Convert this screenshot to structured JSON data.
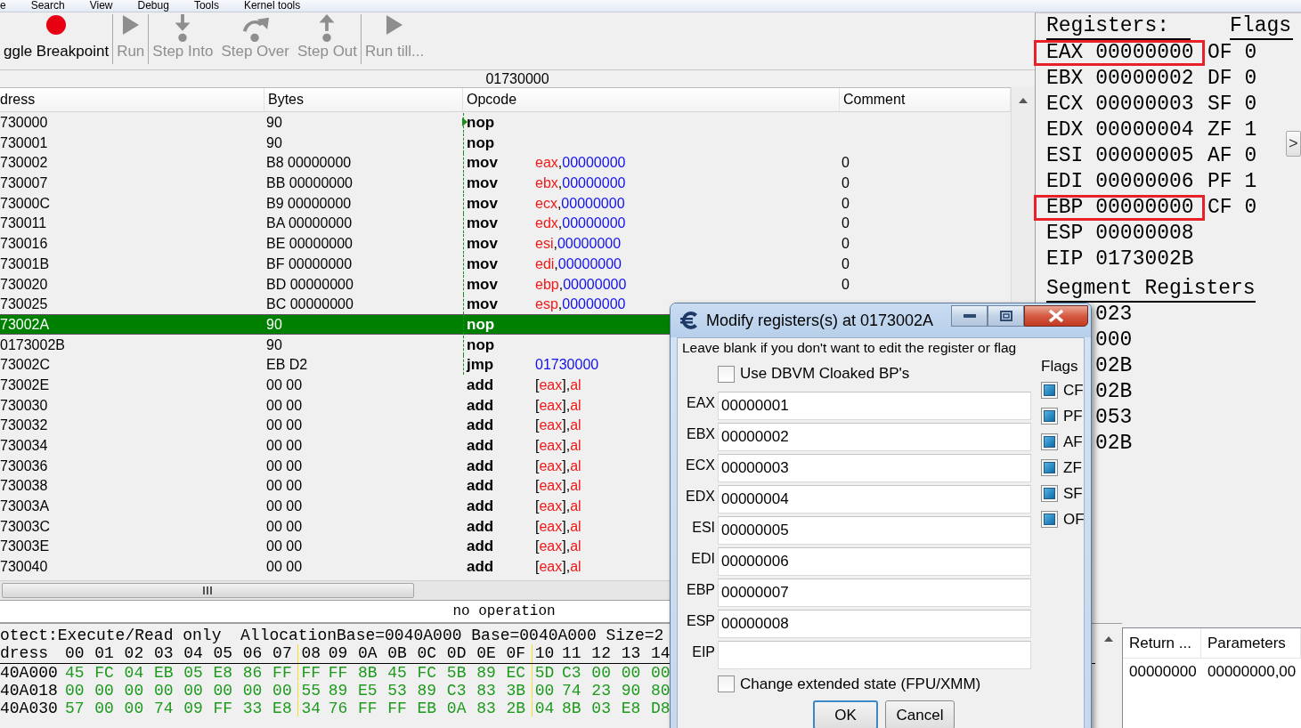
{
  "menu": [
    "e",
    "Search",
    "View",
    "Debug",
    "Tools",
    "Kernel tools"
  ],
  "toolbar": [
    {
      "kind": "breakpoint",
      "label": "ggle Breakpoint",
      "disabled": false,
      "separator_after": true
    },
    {
      "kind": "run",
      "label": "Run",
      "disabled": true,
      "separator_after": true
    },
    {
      "kind": "step_into",
      "label": "Step Into",
      "disabled": true,
      "separator_after": false
    },
    {
      "kind": "step_over",
      "label": "Step Over",
      "disabled": true,
      "separator_after": false
    },
    {
      "kind": "step_out",
      "label": "Step Out",
      "disabled": true,
      "separator_after": true
    },
    {
      "kind": "run",
      "label": "Run till...",
      "disabled": true,
      "separator_after": false
    }
  ],
  "address_bar": "01730000",
  "disassembly": {
    "columns": [
      "dress",
      "Bytes",
      "Opcode",
      "Comment"
    ],
    "rows": [
      {
        "address": "730000",
        "bytes": "90",
        "mnemonic": "nop",
        "selected": false,
        "jump_line": true,
        "jump_target": true
      },
      {
        "address": "730001",
        "bytes": "90",
        "mnemonic": "nop",
        "selected": false,
        "jump_line": true,
        "jump_target": false
      },
      {
        "address": "730002",
        "bytes": "B8 00000000",
        "mnemonic": "mov",
        "operand": [
          {
            "kind": "reg",
            "text": "eax"
          },
          {
            "kind": "sep",
            "text": ","
          },
          {
            "kind": "num",
            "text": "00000000"
          }
        ],
        "comment": "0",
        "selected": false,
        "jump_line": true,
        "jump_target": false
      },
      {
        "address": "730007",
        "bytes": "BB 00000000",
        "mnemonic": "mov",
        "operand": [
          {
            "kind": "reg",
            "text": "ebx"
          },
          {
            "kind": "sep",
            "text": ","
          },
          {
            "kind": "num",
            "text": "00000000"
          }
        ],
        "comment": "0",
        "selected": false,
        "jump_line": true,
        "jump_target": false
      },
      {
        "address": "73000C",
        "bytes": "B9 00000000",
        "mnemonic": "mov",
        "operand": [
          {
            "kind": "reg",
            "text": "ecx"
          },
          {
            "kind": "sep",
            "text": ","
          },
          {
            "kind": "num",
            "text": "00000000"
          }
        ],
        "comment": "0",
        "selected": false,
        "jump_line": true,
        "jump_target": false
      },
      {
        "address": "730011",
        "bytes": "BA 00000000",
        "mnemonic": "mov",
        "operand": [
          {
            "kind": "reg",
            "text": "edx"
          },
          {
            "kind": "sep",
            "text": ","
          },
          {
            "kind": "num",
            "text": "00000000"
          }
        ],
        "comment": "0",
        "selected": false,
        "jump_line": true,
        "jump_target": false
      },
      {
        "address": "730016",
        "bytes": "BE 00000000",
        "mnemonic": "mov",
        "operand": [
          {
            "kind": "reg",
            "text": "esi"
          },
          {
            "kind": "sep",
            "text": ","
          },
          {
            "kind": "num",
            "text": "00000000"
          }
        ],
        "comment": "0",
        "selected": false,
        "jump_line": true,
        "jump_target": false
      },
      {
        "address": "73001B",
        "bytes": "BF 00000000",
        "mnemonic": "mov",
        "operand": [
          {
            "kind": "reg",
            "text": "edi"
          },
          {
            "kind": "sep",
            "text": ","
          },
          {
            "kind": "num",
            "text": "00000000"
          }
        ],
        "comment": "0",
        "selected": false,
        "jump_line": true,
        "jump_target": false
      },
      {
        "address": "730020",
        "bytes": "BD 00000000",
        "mnemonic": "mov",
        "operand": [
          {
            "kind": "reg",
            "text": "ebp"
          },
          {
            "kind": "sep",
            "text": ","
          },
          {
            "kind": "num",
            "text": "00000000"
          }
        ],
        "comment": "0",
        "selected": false,
        "jump_line": true,
        "jump_target": false
      },
      {
        "address": "730025",
        "bytes": "BC 00000000",
        "mnemonic": "mov",
        "operand": [
          {
            "kind": "reg",
            "text": "esp"
          },
          {
            "kind": "sep",
            "text": ","
          },
          {
            "kind": "num",
            "text": "00000000"
          }
        ],
        "selected": false,
        "jump_line": true,
        "jump_target": false
      },
      {
        "address": "73002A",
        "bytes": "90",
        "mnemonic": "nop",
        "selected": true,
        "jump_line": true,
        "jump_target": false
      },
      {
        "address": "0173002B",
        "bytes": "90",
        "mnemonic": "nop",
        "selected": false,
        "jump_line": true,
        "jump_target": false
      },
      {
        "address": "73002C",
        "bytes": "EB D2",
        "mnemonic": "jmp",
        "operand": [
          {
            "kind": "num",
            "text": "01730000"
          }
        ],
        "selected": false,
        "jump_line": true,
        "jump_target": false
      },
      {
        "address": "73002E",
        "bytes": "00 00",
        "mnemonic": "add",
        "operand": [
          {
            "kind": "sep",
            "text": "["
          },
          {
            "kind": "reg",
            "text": "eax"
          },
          {
            "kind": "sep",
            "text": "],"
          },
          {
            "kind": "reg",
            "text": "al"
          }
        ],
        "selected": false,
        "jump_line": false,
        "jump_target": false
      },
      {
        "address": "730030",
        "bytes": "00 00",
        "mnemonic": "add",
        "operand": [
          {
            "kind": "sep",
            "text": "["
          },
          {
            "kind": "reg",
            "text": "eax"
          },
          {
            "kind": "sep",
            "text": "],"
          },
          {
            "kind": "reg",
            "text": "al"
          }
        ],
        "selected": false,
        "jump_line": false,
        "jump_target": false
      },
      {
        "address": "730032",
        "bytes": "00 00",
        "mnemonic": "add",
        "operand": [
          {
            "kind": "sep",
            "text": "["
          },
          {
            "kind": "reg",
            "text": "eax"
          },
          {
            "kind": "sep",
            "text": "],"
          },
          {
            "kind": "reg",
            "text": "al"
          }
        ],
        "selected": false,
        "jump_line": false,
        "jump_target": false
      },
      {
        "address": "730034",
        "bytes": "00 00",
        "mnemonic": "add",
        "operand": [
          {
            "kind": "sep",
            "text": "["
          },
          {
            "kind": "reg",
            "text": "eax"
          },
          {
            "kind": "sep",
            "text": "],"
          },
          {
            "kind": "reg",
            "text": "al"
          }
        ],
        "selected": false,
        "jump_line": false,
        "jump_target": false
      },
      {
        "address": "730036",
        "bytes": "00 00",
        "mnemonic": "add",
        "operand": [
          {
            "kind": "sep",
            "text": "["
          },
          {
            "kind": "reg",
            "text": "eax"
          },
          {
            "kind": "sep",
            "text": "],"
          },
          {
            "kind": "reg",
            "text": "al"
          }
        ],
        "selected": false,
        "jump_line": false,
        "jump_target": false
      },
      {
        "address": "730038",
        "bytes": "00 00",
        "mnemonic": "add",
        "operand": [
          {
            "kind": "sep",
            "text": "["
          },
          {
            "kind": "reg",
            "text": "eax"
          },
          {
            "kind": "sep",
            "text": "],"
          },
          {
            "kind": "reg",
            "text": "al"
          }
        ],
        "selected": false,
        "jump_line": false,
        "jump_target": false
      },
      {
        "address": "73003A",
        "bytes": "00 00",
        "mnemonic": "add",
        "operand": [
          {
            "kind": "sep",
            "text": "["
          },
          {
            "kind": "reg",
            "text": "eax"
          },
          {
            "kind": "sep",
            "text": "],"
          },
          {
            "kind": "reg",
            "text": "al"
          }
        ],
        "selected": false,
        "jump_line": false,
        "jump_target": false
      },
      {
        "address": "73003C",
        "bytes": "00 00",
        "mnemonic": "add",
        "operand": [
          {
            "kind": "sep",
            "text": "["
          },
          {
            "kind": "reg",
            "text": "eax"
          },
          {
            "kind": "sep",
            "text": "],"
          },
          {
            "kind": "reg",
            "text": "al"
          }
        ],
        "selected": false,
        "jump_line": false,
        "jump_target": false
      },
      {
        "address": "73003E",
        "bytes": "00 00",
        "mnemonic": "add",
        "operand": [
          {
            "kind": "sep",
            "text": "["
          },
          {
            "kind": "reg",
            "text": "eax"
          },
          {
            "kind": "sep",
            "text": "],"
          },
          {
            "kind": "reg",
            "text": "al"
          }
        ],
        "selected": false,
        "jump_line": false,
        "jump_target": false
      },
      {
        "address": "730040",
        "bytes": "00 00",
        "mnemonic": "add",
        "operand": [
          {
            "kind": "sep",
            "text": "["
          },
          {
            "kind": "reg",
            "text": "eax"
          },
          {
            "kind": "sep",
            "text": "],"
          },
          {
            "kind": "reg",
            "text": "al"
          }
        ],
        "selected": false,
        "jump_line": false,
        "jump_target": false
      }
    ]
  },
  "status": "no operation",
  "hex": {
    "info": "otect:Execute/Read only  AllocationBase=0040A000 Base=0040A000 Size=2",
    "header_label": "dress",
    "columns": [
      "00",
      "01",
      "02",
      "03",
      "04",
      "05",
      "06",
      "07",
      "08",
      "09",
      "0A",
      "0B",
      "0C",
      "0D",
      "0E",
      "0F",
      "10",
      "11",
      "12",
      "13",
      "14"
    ],
    "rows": [
      {
        "address": "40A000",
        "bytes": [
          "45",
          "FC",
          "04",
          "EB",
          "05",
          "E8",
          "86",
          "FF",
          "FF",
          "FF",
          "8B",
          "45",
          "FC",
          "5B",
          "89",
          "EC",
          "5D",
          "C3",
          "00",
          "00",
          "00"
        ]
      },
      {
        "address": "40A018",
        "bytes": [
          "00",
          "00",
          "00",
          "00",
          "00",
          "00",
          "00",
          "00",
          "55",
          "89",
          "E5",
          "53",
          "89",
          "C3",
          "83",
          "3B",
          "00",
          "74",
          "23",
          "90",
          "80"
        ]
      },
      {
        "address": "40A030",
        "bytes": [
          "57",
          "00",
          "00",
          "74",
          "09",
          "FF",
          "33",
          "E8",
          "34",
          "76",
          "FF",
          "FF",
          "EB",
          "0A",
          "83",
          "2B",
          "04",
          "8B",
          "03",
          "E8",
          "D8"
        ]
      }
    ]
  },
  "registers": {
    "title": "Registers:",
    "flags_title": "Flags",
    "rows": [
      {
        "name": "EAX",
        "value": "00000000",
        "highlighted": true,
        "flag": "OF",
        "flag_value": "0"
      },
      {
        "name": "EBX",
        "value": "00000002",
        "highlighted": false,
        "flag": "DF",
        "flag_value": "0"
      },
      {
        "name": "ECX",
        "value": "00000003",
        "highlighted": false,
        "flag": "SF",
        "flag_value": "0"
      },
      {
        "name": "EDX",
        "value": "00000004",
        "highlighted": false,
        "flag": "ZF",
        "flag_value": "1"
      },
      {
        "name": "ESI",
        "value": "00000005",
        "highlighted": false,
        "flag": "AF",
        "flag_value": "0"
      },
      {
        "name": "EDI",
        "value": "00000006",
        "highlighted": false,
        "flag": "PF",
        "flag_value": "1"
      },
      {
        "name": "EBP",
        "value": "00000000",
        "highlighted": true,
        "flag": "CF",
        "flag_value": "0"
      },
      {
        "name": "ESP",
        "value": "00000008",
        "highlighted": false
      },
      {
        "name": "EIP",
        "value": "0173002B",
        "highlighted": false
      }
    ],
    "segment_title": "Segment Registers",
    "segment_values": [
      "023",
      "000",
      "02B",
      "02B",
      "053",
      "02B"
    ],
    "expand_button": ">"
  },
  "stack": {
    "columns": [
      "Return ...",
      "Parameters"
    ],
    "rows": [
      [
        "00000000",
        "00000000,00"
      ]
    ]
  },
  "dialog": {
    "title": "Modify registers(s) at 0173002A",
    "hint": "Leave blank if you don't want to edit the register or flag",
    "dbvm": {
      "label": "Use DBVM Cloaked BP's",
      "checked": false
    },
    "fields": [
      {
        "label": "EAX",
        "value": "00000001"
      },
      {
        "label": "EBX",
        "value": "00000002"
      },
      {
        "label": "ECX",
        "value": "00000003"
      },
      {
        "label": "EDX",
        "value": "00000004"
      },
      {
        "label": "ESI",
        "value": "00000005"
      },
      {
        "label": "EDI",
        "value": "00000006"
      },
      {
        "label": "EBP",
        "value": "00000007"
      },
      {
        "label": "ESP",
        "value": "00000008"
      },
      {
        "label": "EIP"
      }
    ],
    "flags_title": "Flags",
    "flags": [
      {
        "label": "CF",
        "indeterminate": true
      },
      {
        "label": "PF",
        "indeterminate": true
      },
      {
        "label": "AF",
        "indeterminate": true
      },
      {
        "label": "ZF",
        "indeterminate": true
      },
      {
        "label": "SF",
        "indeterminate": true
      },
      {
        "label": "OF",
        "indeterminate": true
      }
    ],
    "extended": {
      "label": "Change extended state (FPU/XMM)",
      "checked": false
    },
    "buttons": [
      {
        "label": "OK",
        "default": true
      },
      {
        "label": "Cancel",
        "default": false
      }
    ]
  }
}
